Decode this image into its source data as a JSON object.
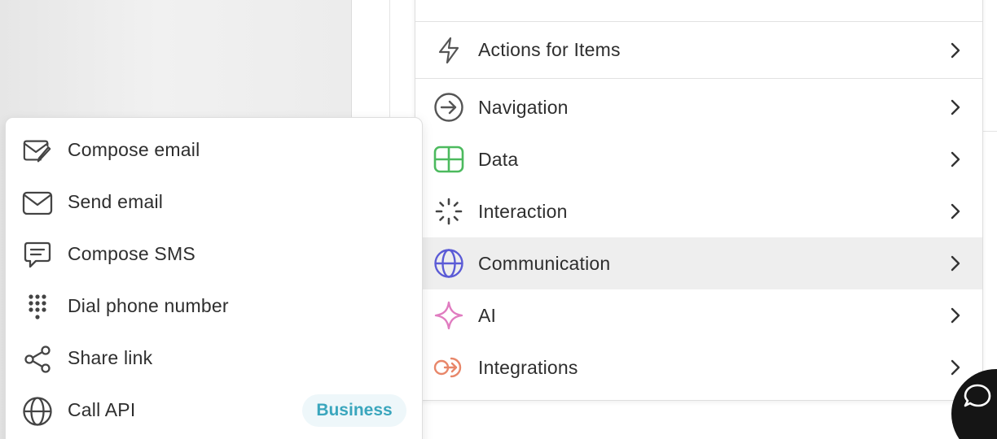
{
  "right_menu": {
    "items": [
      {
        "label": "Actions for Items",
        "icon": "lightning-icon"
      },
      {
        "label": "Navigation",
        "icon": "arrow-circle-icon"
      },
      {
        "label": "Data",
        "icon": "table-icon",
        "color": "#4cba5e"
      },
      {
        "label": "Interaction",
        "icon": "loader-icon"
      },
      {
        "label": "Communication",
        "icon": "globe-icon",
        "color": "#5b5bd6",
        "highlighted": true
      },
      {
        "label": "AI",
        "icon": "sparkle-icon",
        "color": "#e07cc0"
      },
      {
        "label": "Integrations",
        "icon": "integration-icon",
        "color": "#e8876a"
      }
    ]
  },
  "left_menu": {
    "items": [
      {
        "label": "Compose email",
        "icon": "compose-email-icon"
      },
      {
        "label": "Send email",
        "icon": "envelope-icon"
      },
      {
        "label": "Compose SMS",
        "icon": "message-icon"
      },
      {
        "label": "Dial phone number",
        "icon": "dialpad-icon"
      },
      {
        "label": "Share link",
        "icon": "share-icon"
      },
      {
        "label": "Call API",
        "icon": "globe-icon",
        "badge": "Business"
      }
    ]
  },
  "colors": {
    "highlight_bg": "#eeeeee",
    "badge_bg": "#eef7fa",
    "badge_text": "#3aa6bd"
  }
}
